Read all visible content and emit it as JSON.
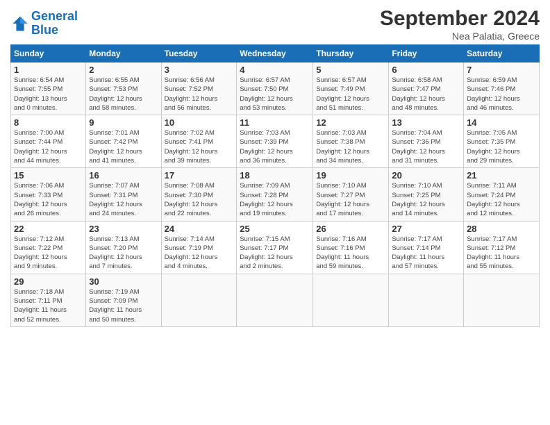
{
  "header": {
    "logo_line1": "General",
    "logo_line2": "Blue",
    "month_year": "September 2024",
    "location": "Nea Palatia, Greece"
  },
  "weekdays": [
    "Sunday",
    "Monday",
    "Tuesday",
    "Wednesday",
    "Thursday",
    "Friday",
    "Saturday"
  ],
  "weeks": [
    [
      {
        "day": "1",
        "info": "Sunrise: 6:54 AM\nSunset: 7:55 PM\nDaylight: 13 hours\nand 0 minutes."
      },
      {
        "day": "2",
        "info": "Sunrise: 6:55 AM\nSunset: 7:53 PM\nDaylight: 12 hours\nand 58 minutes."
      },
      {
        "day": "3",
        "info": "Sunrise: 6:56 AM\nSunset: 7:52 PM\nDaylight: 12 hours\nand 56 minutes."
      },
      {
        "day": "4",
        "info": "Sunrise: 6:57 AM\nSunset: 7:50 PM\nDaylight: 12 hours\nand 53 minutes."
      },
      {
        "day": "5",
        "info": "Sunrise: 6:57 AM\nSunset: 7:49 PM\nDaylight: 12 hours\nand 51 minutes."
      },
      {
        "day": "6",
        "info": "Sunrise: 6:58 AM\nSunset: 7:47 PM\nDaylight: 12 hours\nand 48 minutes."
      },
      {
        "day": "7",
        "info": "Sunrise: 6:59 AM\nSunset: 7:46 PM\nDaylight: 12 hours\nand 46 minutes."
      }
    ],
    [
      {
        "day": "8",
        "info": "Sunrise: 7:00 AM\nSunset: 7:44 PM\nDaylight: 12 hours\nand 44 minutes."
      },
      {
        "day": "9",
        "info": "Sunrise: 7:01 AM\nSunset: 7:42 PM\nDaylight: 12 hours\nand 41 minutes."
      },
      {
        "day": "10",
        "info": "Sunrise: 7:02 AM\nSunset: 7:41 PM\nDaylight: 12 hours\nand 39 minutes."
      },
      {
        "day": "11",
        "info": "Sunrise: 7:03 AM\nSunset: 7:39 PM\nDaylight: 12 hours\nand 36 minutes."
      },
      {
        "day": "12",
        "info": "Sunrise: 7:03 AM\nSunset: 7:38 PM\nDaylight: 12 hours\nand 34 minutes."
      },
      {
        "day": "13",
        "info": "Sunrise: 7:04 AM\nSunset: 7:36 PM\nDaylight: 12 hours\nand 31 minutes."
      },
      {
        "day": "14",
        "info": "Sunrise: 7:05 AM\nSunset: 7:35 PM\nDaylight: 12 hours\nand 29 minutes."
      }
    ],
    [
      {
        "day": "15",
        "info": "Sunrise: 7:06 AM\nSunset: 7:33 PM\nDaylight: 12 hours\nand 26 minutes."
      },
      {
        "day": "16",
        "info": "Sunrise: 7:07 AM\nSunset: 7:31 PM\nDaylight: 12 hours\nand 24 minutes."
      },
      {
        "day": "17",
        "info": "Sunrise: 7:08 AM\nSunset: 7:30 PM\nDaylight: 12 hours\nand 22 minutes."
      },
      {
        "day": "18",
        "info": "Sunrise: 7:09 AM\nSunset: 7:28 PM\nDaylight: 12 hours\nand 19 minutes."
      },
      {
        "day": "19",
        "info": "Sunrise: 7:10 AM\nSunset: 7:27 PM\nDaylight: 12 hours\nand 17 minutes."
      },
      {
        "day": "20",
        "info": "Sunrise: 7:10 AM\nSunset: 7:25 PM\nDaylight: 12 hours\nand 14 minutes."
      },
      {
        "day": "21",
        "info": "Sunrise: 7:11 AM\nSunset: 7:24 PM\nDaylight: 12 hours\nand 12 minutes."
      }
    ],
    [
      {
        "day": "22",
        "info": "Sunrise: 7:12 AM\nSunset: 7:22 PM\nDaylight: 12 hours\nand 9 minutes."
      },
      {
        "day": "23",
        "info": "Sunrise: 7:13 AM\nSunset: 7:20 PM\nDaylight: 12 hours\nand 7 minutes."
      },
      {
        "day": "24",
        "info": "Sunrise: 7:14 AM\nSunset: 7:19 PM\nDaylight: 12 hours\nand 4 minutes."
      },
      {
        "day": "25",
        "info": "Sunrise: 7:15 AM\nSunset: 7:17 PM\nDaylight: 12 hours\nand 2 minutes."
      },
      {
        "day": "26",
        "info": "Sunrise: 7:16 AM\nSunset: 7:16 PM\nDaylight: 11 hours\nand 59 minutes."
      },
      {
        "day": "27",
        "info": "Sunrise: 7:17 AM\nSunset: 7:14 PM\nDaylight: 11 hours\nand 57 minutes."
      },
      {
        "day": "28",
        "info": "Sunrise: 7:17 AM\nSunset: 7:12 PM\nDaylight: 11 hours\nand 55 minutes."
      }
    ],
    [
      {
        "day": "29",
        "info": "Sunrise: 7:18 AM\nSunset: 7:11 PM\nDaylight: 11 hours\nand 52 minutes."
      },
      {
        "day": "30",
        "info": "Sunrise: 7:19 AM\nSunset: 7:09 PM\nDaylight: 11 hours\nand 50 minutes."
      },
      {
        "day": "",
        "info": ""
      },
      {
        "day": "",
        "info": ""
      },
      {
        "day": "",
        "info": ""
      },
      {
        "day": "",
        "info": ""
      },
      {
        "day": "",
        "info": ""
      }
    ]
  ]
}
